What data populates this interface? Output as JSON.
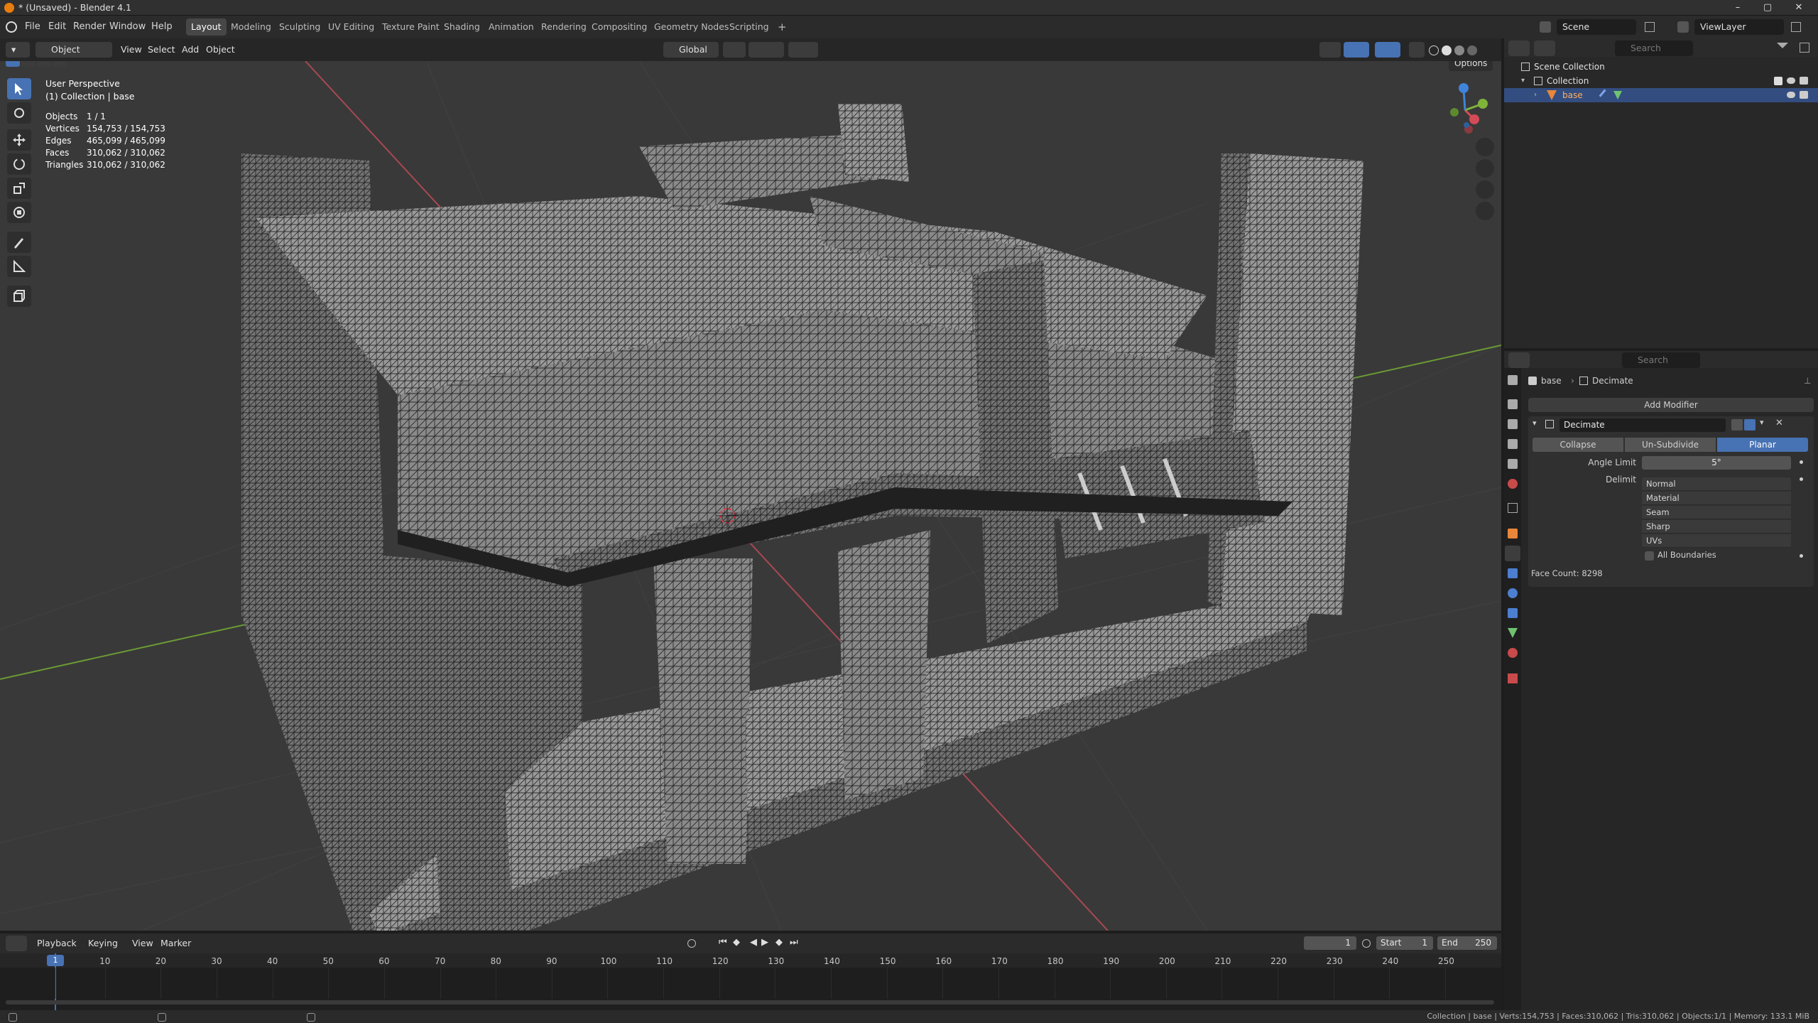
{
  "window": {
    "title": "* (Unsaved) - Blender 4.1"
  },
  "menu": [
    "File",
    "Edit",
    "Render",
    "Window",
    "Help"
  ],
  "workspaces": [
    "Layout",
    "Modeling",
    "Sculpting",
    "UV Editing",
    "Texture Paint",
    "Shading",
    "Animation",
    "Rendering",
    "Compositing",
    "Geometry Nodes",
    "Scripting"
  ],
  "active_workspace": "Layout",
  "scene": {
    "name": "Scene",
    "view_layer": "ViewLayer"
  },
  "viewport_header": {
    "mode": "Object Mode",
    "menus": [
      "View",
      "Select",
      "Add",
      "Object"
    ],
    "transform_orientation": "Global",
    "options": "Options"
  },
  "overlay": {
    "view_name": "User Perspective",
    "collection_line": "(1) Collection | base",
    "stats": [
      {
        "label": "Objects",
        "value": "1 / 1"
      },
      {
        "label": "Vertices",
        "value": "154,753 / 154,753"
      },
      {
        "label": "Edges",
        "value": "465,099 / 465,099"
      },
      {
        "label": "Faces",
        "value": "310,062 / 310,062"
      },
      {
        "label": "Triangles",
        "value": "310,062 / 310,062"
      }
    ]
  },
  "outliner": {
    "search_placeholder": "Search",
    "items": [
      {
        "label": "Scene Collection"
      },
      {
        "label": "Collection"
      },
      {
        "label": "base"
      }
    ]
  },
  "properties": {
    "search_placeholder": "Search",
    "breadcrumb": [
      "base",
      "Decimate"
    ],
    "add_modifier": "Add Modifier",
    "modifier_name": "Decimate",
    "mode_tabs": [
      "Collapse",
      "Un-Subdivide",
      "Planar"
    ],
    "active_tab": "Planar",
    "angle_limit_label": "Angle Limit",
    "angle_limit_value": "5°",
    "delimit_label": "Delimit",
    "delimit_options": [
      "Normal",
      "Material",
      "Seam",
      "Sharp",
      "UVs"
    ],
    "all_boundaries": "All Boundaries",
    "face_count": "Face Count: 8298"
  },
  "timeline": {
    "menus": [
      "Playback",
      "Keying",
      "View",
      "Marker"
    ],
    "current_frame": "1",
    "start_label": "Start",
    "start": "1",
    "end_label": "End",
    "end": "250",
    "ticks": [
      "1",
      "10",
      "20",
      "30",
      "40",
      "50",
      "60",
      "70",
      "80",
      "90",
      "100",
      "110",
      "120",
      "130",
      "140",
      "150",
      "160",
      "170",
      "180",
      "190",
      "200",
      "210",
      "220",
      "230",
      "240",
      "250"
    ]
  },
  "statusbar": {
    "text": "Collection | base | Verts:154,753 | Faces:310,062 | Tris:310,062 | Objects:1/1 | Memory: 133.1 MiB"
  },
  "colors": {
    "accent": "#4772b3",
    "x_axis": "#d24c57",
    "y_axis": "#7fb33a",
    "z_axis": "#3f84d8",
    "wire": "#1f1f1f",
    "mesh": "#8d8d8d"
  }
}
